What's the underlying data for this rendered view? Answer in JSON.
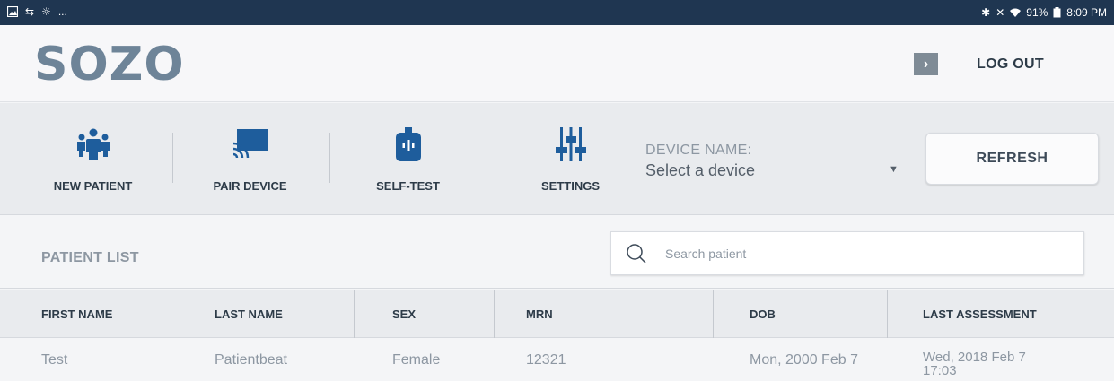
{
  "status_bar": {
    "left_icons": [
      "image-icon",
      "sync-icon",
      "weather-icon"
    ],
    "ellipsis": "...",
    "battery": "91%",
    "time": "8:09 PM"
  },
  "header": {
    "logo": "SOZO",
    "trademark": "™",
    "logout_label": "LOG OUT"
  },
  "toolbar": {
    "tools": [
      {
        "label": "NEW PATIENT",
        "icon": "people-icon"
      },
      {
        "label": "PAIR DEVICE",
        "icon": "cast-icon"
      },
      {
        "label": "SELF-TEST",
        "icon": "device-icon"
      },
      {
        "label": "SETTINGS",
        "icon": "sliders-icon"
      }
    ],
    "device_name_label": "DEVICE NAME:",
    "device_select_value": "Select a device",
    "refresh_label": "REFRESH"
  },
  "patient_list": {
    "title": "PATIENT LIST",
    "search_placeholder": "Search patient"
  },
  "table": {
    "columns": [
      "FIRST NAME",
      "LAST NAME",
      "SEX",
      "MRN",
      "DOB",
      "LAST ASSESSMENT"
    ],
    "rows": [
      {
        "first_name": "Test",
        "last_name": "Patientbeat",
        "sex": "Female",
        "mrn": "12321",
        "dob": "Mon, 2000 Feb 7",
        "last_assessment_date": "Wed, 2018 Feb 7",
        "last_assessment_time": "17:03"
      }
    ]
  },
  "colors": {
    "status_bar": "#1f3651",
    "accent_icon": "#1e5d9c",
    "logo": "#6e8498"
  }
}
